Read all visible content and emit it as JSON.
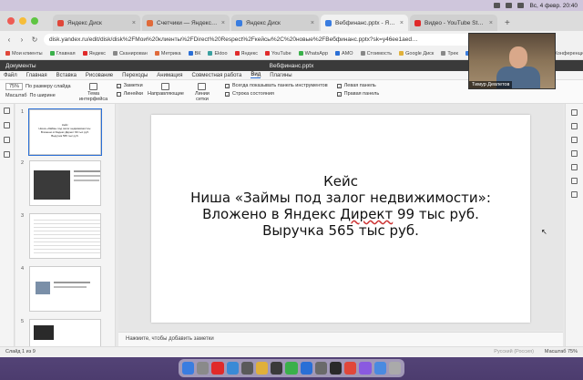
{
  "menubar": {
    "datetime": "Вс, 4 февр.  20:40"
  },
  "browser": {
    "tabs": [
      {
        "label": "Яндекс Диск",
        "color": "#e0473a",
        "active": false
      },
      {
        "label": "Счетчики — Яндекс.Метрика",
        "color": "#e06a3a",
        "active": false
      },
      {
        "label": "Яндекс Диск",
        "color": "#3a7de0",
        "active": false
      },
      {
        "label": "Вебфинанс.pptx - Яндекс Д",
        "color": "#3a7de0",
        "active": true
      },
      {
        "label": "Видео - YouTube Studio",
        "color": "#e02a2a",
        "active": false
      }
    ],
    "url": "disk.yandex.ru/edit/disk/disk%2FМои%20клиенты%2FDirect%20Respect%2Fкейсы%2C%20новые%2FВебфинанс.pptx?sk=y46ee1aed…",
    "bookmarks": [
      {
        "label": "Мои клиенты",
        "color": "#e0473a"
      },
      {
        "label": "Главная",
        "color": "#3ab04a"
      },
      {
        "label": "Яндекс",
        "color": "#e02a2a"
      },
      {
        "label": "Сканирован",
        "color": "#888888"
      },
      {
        "label": "Метрика",
        "color": "#e06a3a"
      },
      {
        "label": "ВК",
        "color": "#2a6fd6"
      },
      {
        "label": "Ektoo",
        "color": "#3aa0a0"
      },
      {
        "label": "Яндекс",
        "color": "#e02a2a"
      },
      {
        "label": "YouTube",
        "color": "#e02a2a"
      },
      {
        "label": "WhatsApp",
        "color": "#3ab04a"
      },
      {
        "label": "AMO",
        "color": "#2a6fd6"
      },
      {
        "label": "Стоимость",
        "color": "#888888"
      },
      {
        "label": "Google Диск",
        "color": "#e0b03a"
      },
      {
        "label": "Трек",
        "color": "#888888"
      },
      {
        "label": "Диск",
        "color": "#3a7de0"
      },
      {
        "label": "Почта",
        "color": "#e0473a"
      },
      {
        "label": "Яндекс",
        "color": "#e02a2a"
      },
      {
        "label": "Конференция",
        "color": "#3ab04a"
      }
    ]
  },
  "app": {
    "name": "Документы",
    "doc_title": "Вебфинанс.pptx",
    "ribbon_tabs": [
      "Файл",
      "Главная",
      "Вставка",
      "Рисование",
      "Переходы",
      "Анимация",
      "Совместная работа",
      "Вид",
      "Плагины"
    ],
    "active_tab_index": 7,
    "ribbon": {
      "zoom_value": "75%",
      "fit_slide": "По размеру слайда",
      "fit_width": "По ширине",
      "zoom_label": "Масштаб",
      "theme_label": "Тема интерфейса",
      "notes_label": "Заметки",
      "rulers_label": "Линейки",
      "guides_label": "Направляющие",
      "gridlines_label": "Линии сетки",
      "toolbar_always_label": "Всегда показывать панель инструментов",
      "status_bar_label": "Строка состояния",
      "left_panel_label": "Левая панель",
      "right_panel_label": "Правая панель"
    }
  },
  "thumbs": [
    {
      "num": "1",
      "text": "Кейс\nНиша «Займы под залог недвижимости»:\nВложено в Яндекс Директ 99 тыс руб.\nВыручка 565 тыс руб."
    },
    {
      "num": "2"
    },
    {
      "num": "3"
    },
    {
      "num": "4"
    },
    {
      "num": "5"
    }
  ],
  "slide": {
    "line1": "Кейс",
    "line2": "Ниша «Займы под залог недвижимости»:",
    "line3a": "Вложено в Яндекс ",
    "line3b": "Директ",
    "line3c": " 99 тыс руб.",
    "line4": "Выручка 565 тыс руб."
  },
  "notes_placeholder": "Нажмите, чтобы добавить заметки",
  "status": {
    "slide_of": "Слайд 1 из 9",
    "language": "Русский (Россия)",
    "zoom": "Масштаб 75%"
  },
  "webcam": {
    "name": "Тимур Девлетов"
  },
  "dock_colors": [
    "#3a7de0",
    "#8a8a8a",
    "#e02a2a",
    "#3a8ad6",
    "#5a5a5a",
    "#e0b03a",
    "#3a3a3a",
    "#3ab04a",
    "#2a6fd6",
    "#6a6a6a",
    "#2a2a2a",
    "#e0473a",
    "#8a5ae0",
    "#4a8ae0",
    "#aaaaaa"
  ]
}
